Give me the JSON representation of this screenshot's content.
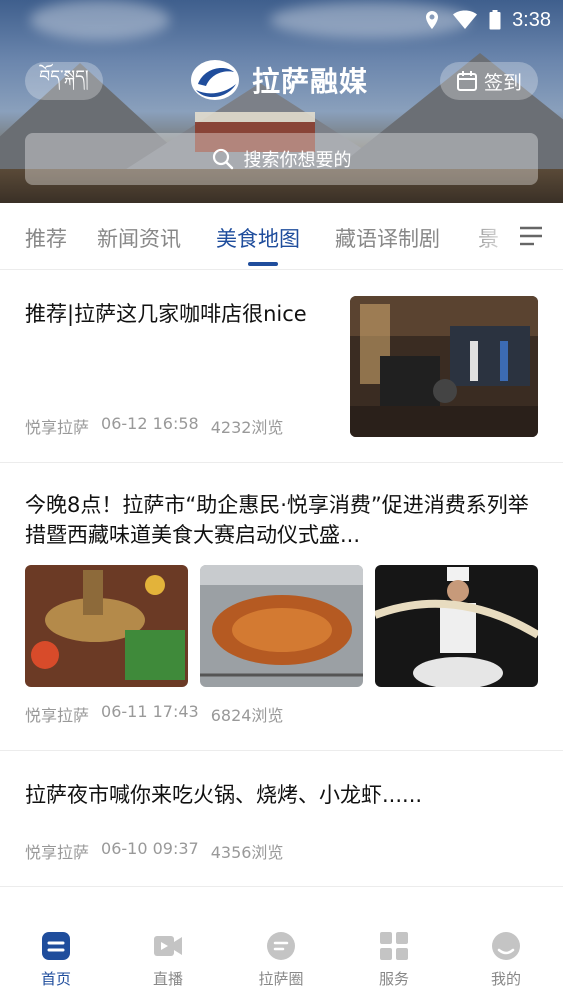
{
  "status_bar": {
    "time": "3:38"
  },
  "header": {
    "tibetan_label": "བོད་སྐད།",
    "logo_text": "拉萨融媒",
    "signin_label": "签到",
    "search_placeholder": "搜索你想要的"
  },
  "tabs": [
    {
      "label": "推荐"
    },
    {
      "label": "新闻资讯"
    },
    {
      "label": "美食地图"
    },
    {
      "label": "藏语译制剧"
    },
    {
      "label": "景"
    }
  ],
  "active_tab": "美食地图",
  "articles": [
    {
      "title": "推荐|拉萨这几家咖啡店很nice",
      "source": "悦享拉萨",
      "time": "06-12 16:58",
      "views": "4232浏览"
    },
    {
      "title": "今晚8点！拉萨市“助企惠民·悦享消费”促进消费系列举措暨西藏味道美食大赛启动仪式盛...",
      "source": "悦享拉萨",
      "time": "06-11 17:43",
      "views": "6824浏览"
    },
    {
      "title": "拉萨夜市喊你来吃火锅、烧烤、小龙虾......",
      "source": "悦享拉萨",
      "time": "06-10 09:37",
      "views": "4356浏览"
    }
  ],
  "bottom_nav": [
    {
      "label": "首页",
      "icon": "home-icon"
    },
    {
      "label": "直播",
      "icon": "video-icon"
    },
    {
      "label": "拉萨圈",
      "icon": "chat-icon"
    },
    {
      "label": "服务",
      "icon": "grid-icon"
    },
    {
      "label": "我的",
      "icon": "user-icon"
    }
  ],
  "colors": {
    "accent": "#1f4d9c",
    "muted": "#888888"
  }
}
